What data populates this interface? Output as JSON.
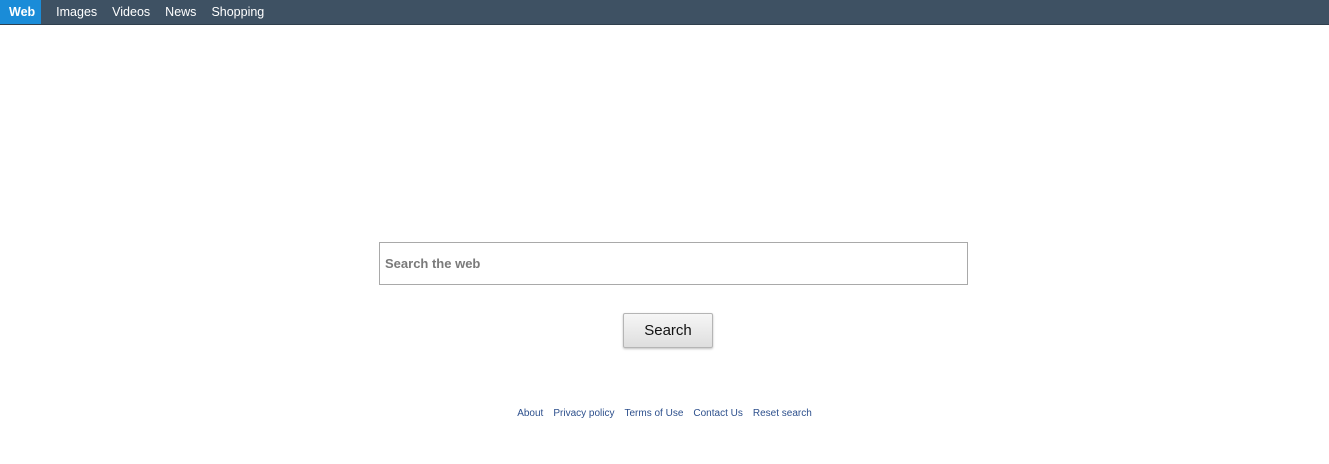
{
  "nav": {
    "tabs": [
      {
        "label": "Web",
        "active": true
      },
      {
        "label": "Images",
        "active": false
      },
      {
        "label": "Videos",
        "active": false
      },
      {
        "label": "News",
        "active": false
      },
      {
        "label": "Shopping",
        "active": false
      }
    ]
  },
  "search": {
    "placeholder": "Search the web",
    "value": "",
    "button_label": "Search"
  },
  "footer": {
    "links": [
      "About",
      "Privacy policy",
      "Terms of Use",
      "Contact Us",
      "Reset search"
    ]
  },
  "colors": {
    "topbar": "#3e5163",
    "active_tab": "#1a8cd8",
    "footer_link": "#2c4f8c"
  }
}
